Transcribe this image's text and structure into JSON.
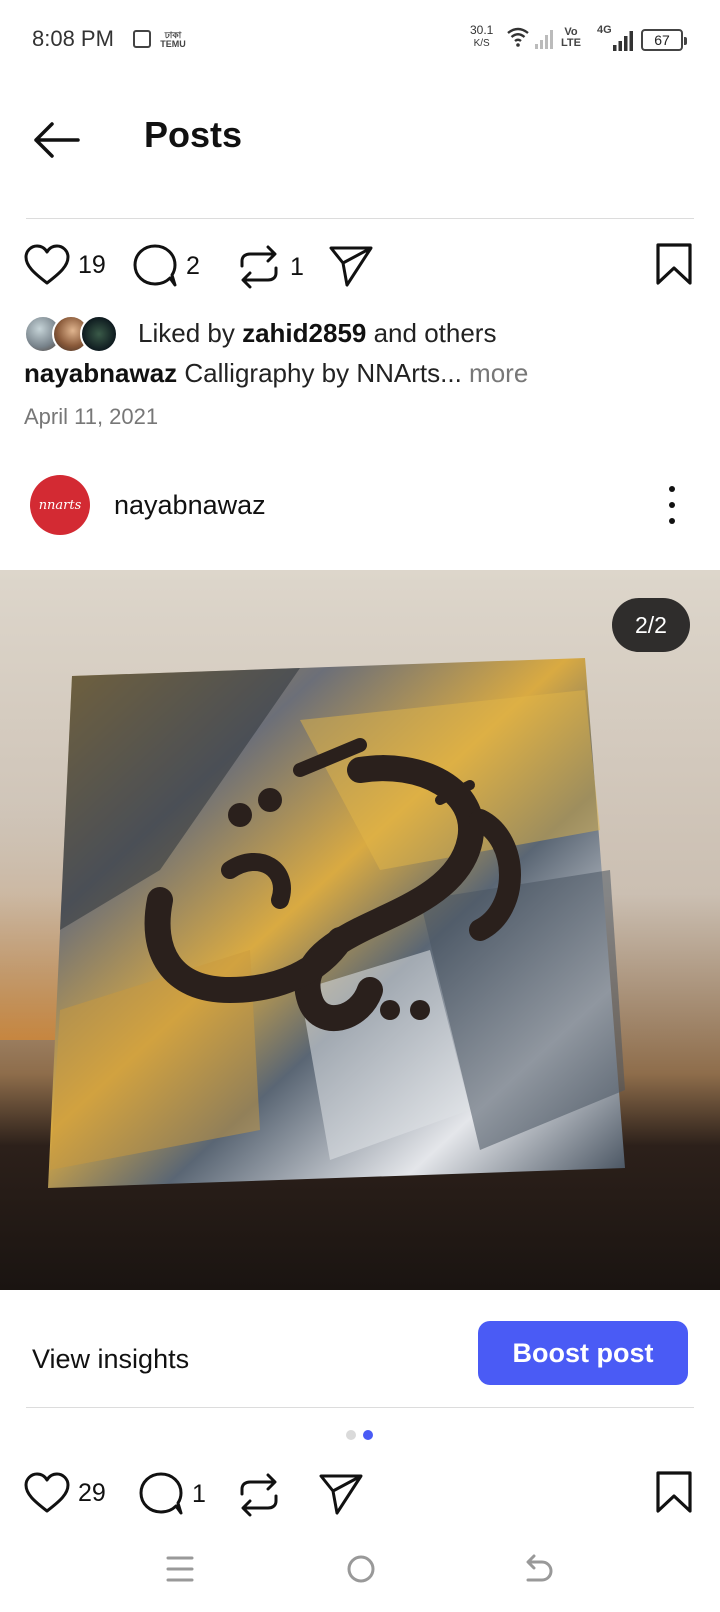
{
  "status_bar": {
    "time": "8:08 PM",
    "notif_label_top": "ঢাকা",
    "notif_label_bottom": "TEMU",
    "net_speed_value": "30.1",
    "net_speed_unit": "K/S",
    "volte_top": "Vo",
    "volte_bottom": "LTE",
    "network_type": "4G",
    "battery": "67"
  },
  "header": {
    "title": "Posts",
    "back_icon": "arrow-left-icon"
  },
  "post1": {
    "likes": "19",
    "comments": "2",
    "reposts": "1",
    "liked_by_prefix": "Liked by ",
    "liked_by_user": "zahid2859",
    "liked_by_suffix": " and others",
    "caption_user": "nayabnawaz",
    "caption_text": " Calligraphy by NNArts...",
    "caption_more": " more",
    "date": "April 11, 2021"
  },
  "post2": {
    "username": "nayabnawaz",
    "avatar_text": "nnarts",
    "image_counter": "2/2",
    "view_insights": "View insights",
    "boost_post": "Boost post",
    "likes": "29",
    "comments": "1",
    "carousel_active_index": 1,
    "carousel_count": 2
  },
  "colors": {
    "accent": "#4a5bf5",
    "avatar_red": "#d32a33"
  },
  "nav": {
    "icons": [
      "menu-icon",
      "home-circle-icon",
      "back-icon"
    ]
  }
}
